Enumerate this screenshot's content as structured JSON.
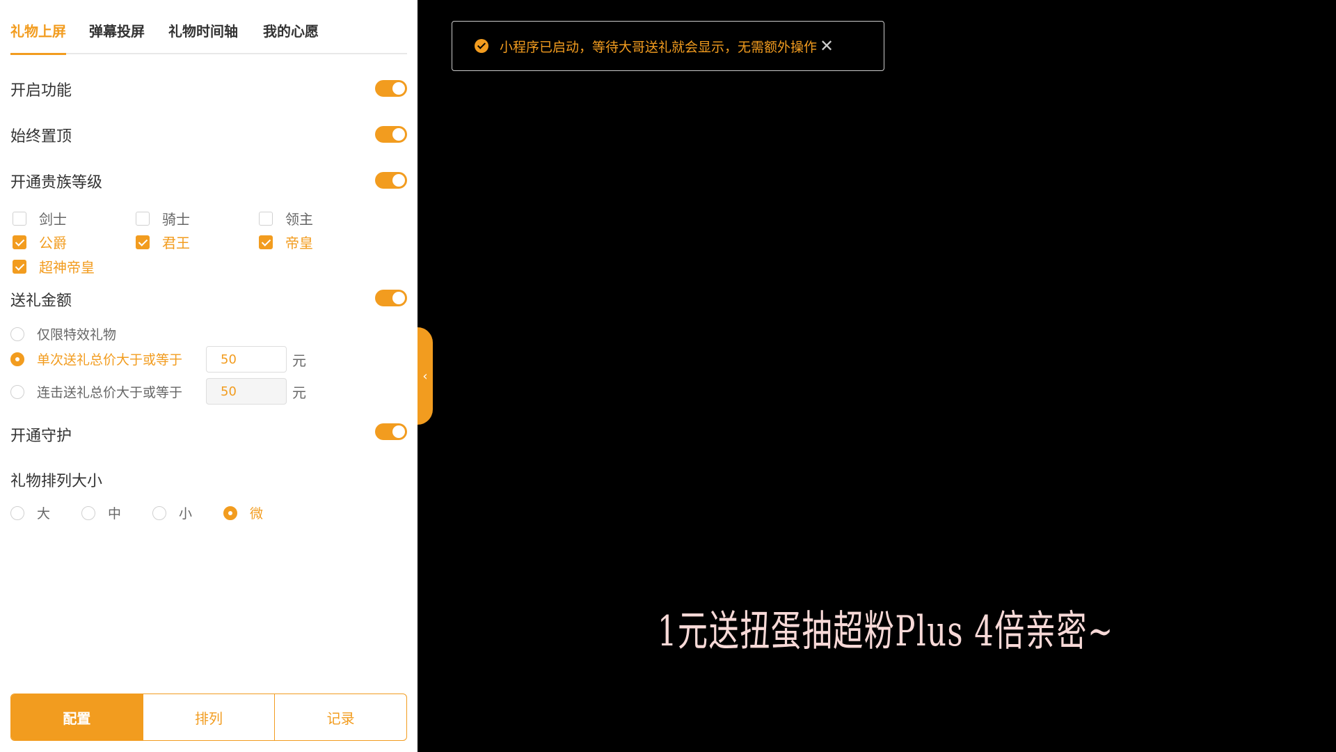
{
  "tabs": [
    "礼物上屏",
    "弹幕投屏",
    "礼物时间轴",
    "我的心愿"
  ],
  "settings": {
    "enable": "开启功能",
    "always_top": "始终置顶",
    "noble_level": "开通贵族等级",
    "gift_amount": "送礼金额",
    "guard": "开通守护",
    "gift_size": "礼物排列大小"
  },
  "noble_levels": [
    {
      "label": "剑士",
      "checked": false
    },
    {
      "label": "骑士",
      "checked": false
    },
    {
      "label": "领主",
      "checked": false
    },
    {
      "label": "公爵",
      "checked": true
    },
    {
      "label": "君王",
      "checked": true
    },
    {
      "label": "帝皇",
      "checked": true
    },
    {
      "label": "超神帝皇",
      "checked": true
    }
  ],
  "amount_options": [
    {
      "label": "仅限特效礼物",
      "selected": false
    },
    {
      "label": "单次送礼总价大于或等于",
      "selected": true,
      "value": "50",
      "unit": "元"
    },
    {
      "label": "连击送礼总价大于或等于",
      "selected": false,
      "value": "50",
      "unit": "元"
    }
  ],
  "size_options": [
    {
      "label": "大",
      "selected": false
    },
    {
      "label": "中",
      "selected": false
    },
    {
      "label": "小",
      "selected": false
    },
    {
      "label": "微",
      "selected": true
    }
  ],
  "bottom_buttons": [
    "配置",
    "排列",
    "记录"
  ],
  "notice": {
    "text": "小程序已启动，等待大哥送礼就会显示，无需额外操作",
    "close": "✕"
  },
  "marquee": "1元送扭蛋抽超粉Plus  4倍亲密~",
  "colors": {
    "accent": "#f29c1f"
  }
}
